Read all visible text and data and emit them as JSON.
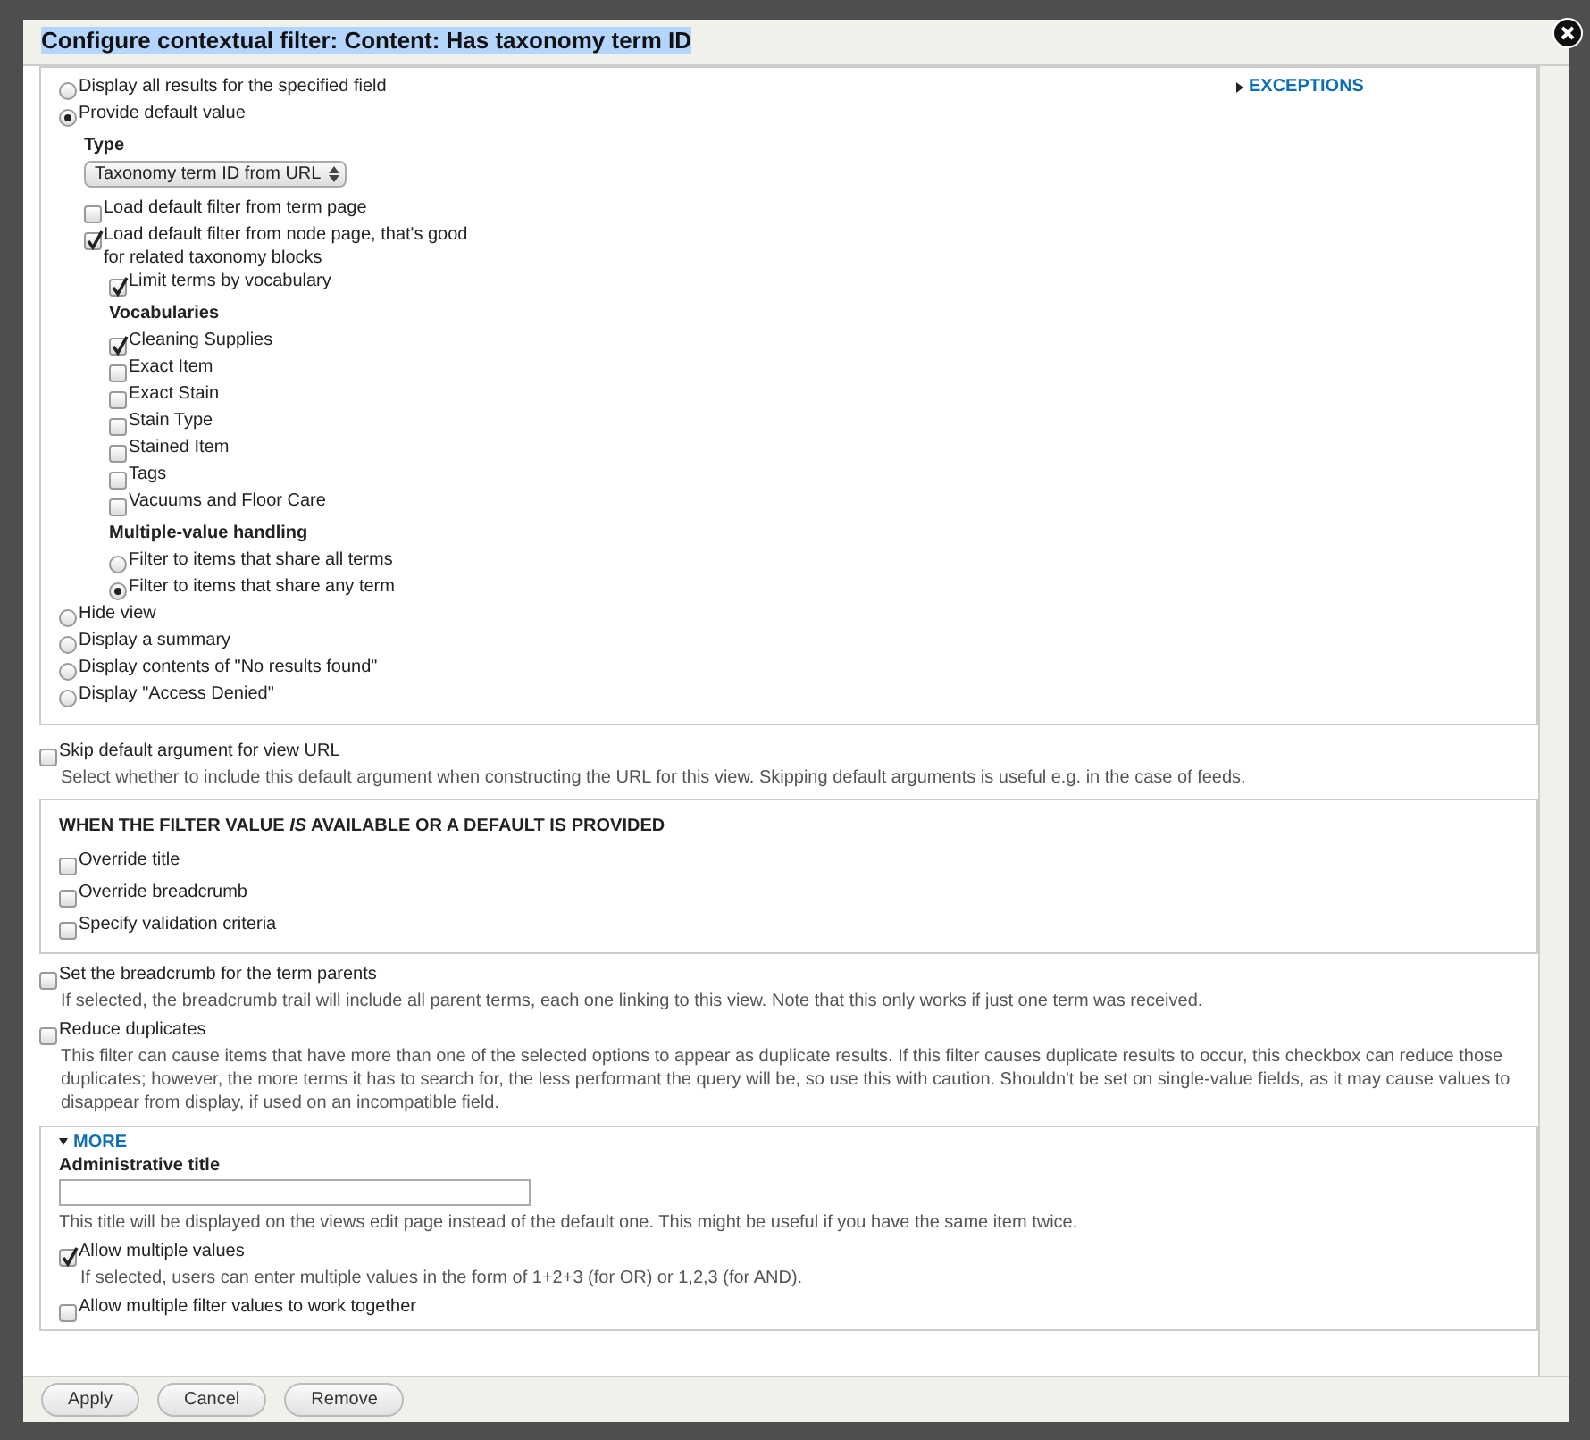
{
  "dialog": {
    "title": "Configure contextual filter: Content: Has taxonomy term ID"
  },
  "exceptions": {
    "label": "EXCEPTIONS",
    "expanded": false
  },
  "options": [
    {
      "kind": "radio",
      "label": "Display all results for the specified field",
      "selected": false
    },
    {
      "kind": "radio",
      "label": "Provide default value",
      "selected": true,
      "children": [
        {
          "kind": "heading",
          "label": "Type"
        },
        {
          "kind": "select",
          "value": "Taxonomy term ID from URL"
        },
        {
          "kind": "checkbox",
          "label": "Load default filter from term page",
          "checked": false
        },
        {
          "kind": "checkbox",
          "label": "Load default filter from node page, that's good for related taxonomy blocks",
          "checked": true,
          "children": [
            {
              "kind": "checkbox",
              "label": "Limit terms by vocabulary",
              "checked": true
            },
            {
              "kind": "heading",
              "label": "Vocabularies"
            },
            {
              "kind": "checkbox",
              "label": "Cleaning Supplies",
              "checked": true
            },
            {
              "kind": "checkbox",
              "label": "Exact Item",
              "checked": false
            },
            {
              "kind": "checkbox",
              "label": "Exact Stain",
              "checked": false
            },
            {
              "kind": "checkbox",
              "label": "Stain Type",
              "checked": false
            },
            {
              "kind": "checkbox",
              "label": "Stained Item",
              "checked": false
            },
            {
              "kind": "checkbox",
              "label": "Tags",
              "checked": false
            },
            {
              "kind": "checkbox",
              "label": "Vacuums and Floor Care",
              "checked": false
            },
            {
              "kind": "heading",
              "label": "Multiple-value handling"
            },
            {
              "kind": "radio",
              "label": "Filter to items that share all terms",
              "selected": false
            },
            {
              "kind": "radio",
              "label": "Filter to items that share any term",
              "selected": true
            }
          ]
        }
      ]
    },
    {
      "kind": "radio",
      "label": "Hide view",
      "selected": false
    },
    {
      "kind": "radio",
      "label": "Display a summary",
      "selected": false
    },
    {
      "kind": "radio",
      "label": "Display contents of \"No results found\"",
      "selected": false
    },
    {
      "kind": "radio",
      "label": "Display \"Access Denied\"",
      "selected": false
    }
  ],
  "skip_default": {
    "label": "Skip default argument for view URL",
    "checked": false,
    "description": "Select whether to include this default argument when constructing the URL for this view. Skipping default arguments is useful e.g. in the case of feeds."
  },
  "validation": {
    "title": "WHEN THE FILTER VALUE *IS* AVAILABLE OR A DEFAULT IS PROVIDED",
    "items": [
      {
        "label": "Override title",
        "checked": false
      },
      {
        "label": "Override breadcrumb",
        "checked": false
      },
      {
        "label": "Specify validation criteria",
        "checked": false
      }
    ]
  },
  "after": [
    {
      "label": "Set the breadcrumb for the term parents",
      "checked": false,
      "description": "If selected, the breadcrumb trail will include all parent terms, each one linking to this view. Note that this only works if just one term was received."
    },
    {
      "label": "Reduce duplicates",
      "checked": false,
      "description": "This filter can cause items that have more than one of the selected options to appear as duplicate results. If this filter causes duplicate results to occur, this checkbox can reduce those duplicates; however, the more terms it has to search for, the less performant the query will be, so use this with caution. Shouldn't be set on single-value fields, as it may cause values to disappear from display, if used on an incompatible field."
    }
  ],
  "more": {
    "legend": "MORE",
    "expanded": true,
    "title_label": "Administrative title",
    "title_description": "This title will be displayed on the views edit page instead of the default one. This might be useful if you have the same item twice.",
    "items": [
      {
        "label": "Allow multiple values",
        "checked": true,
        "description": "If selected, users can enter multiple values in the form of 1+2+3 (for OR) or 1,2,3 (for AND)."
      },
      {
        "label": "Allow multiple filter values to work together",
        "checked": false
      }
    ]
  },
  "buttons": [
    "Apply",
    "Cancel",
    "Remove"
  ]
}
